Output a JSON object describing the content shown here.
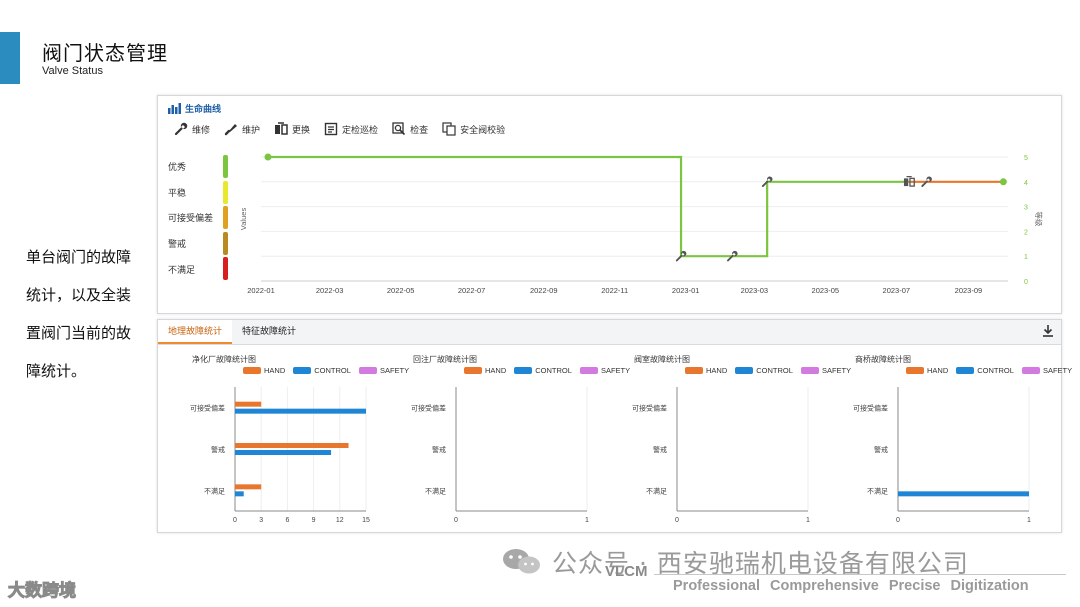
{
  "header": {
    "title": "阀门状态管理",
    "subtitle": "Valve Status"
  },
  "description": "单台阀门的故障统计，以及全装置阀门当前的故障统计。",
  "life_panel": {
    "title": "生命曲线",
    "toolbar": [
      {
        "label": "维修",
        "icon": "wrench-icon"
      },
      {
        "label": "维护",
        "icon": "brush-icon"
      },
      {
        "label": "更换",
        "icon": "replace-icon"
      },
      {
        "label": "定检巡检",
        "icon": "inspection-icon"
      },
      {
        "label": "检查",
        "icon": "check-search-icon"
      },
      {
        "label": "安全阀校验",
        "icon": "copy-verify-icon"
      }
    ],
    "levels": [
      {
        "label": "优秀",
        "color": "#7cc540"
      },
      {
        "label": "平稳",
        "color": "#e8e82c"
      },
      {
        "label": "可接受偏差",
        "color": "#e0a020"
      },
      {
        "label": "警戒",
        "color": "#b88a20"
      },
      {
        "label": "不满足",
        "color": "#d81e1e"
      }
    ]
  },
  "chart_data": [
    {
      "type": "line",
      "title": "生命曲线",
      "ylabel": "Values",
      "y2label": "等级",
      "ylim": [
        0,
        5
      ],
      "x_ticks": [
        "2022-01",
        "2022-03",
        "2022-05",
        "2022-07",
        "2022-09",
        "2022-11",
        "2023-01",
        "2023-03",
        "2023-05",
        "2023-07",
        "2023-09"
      ],
      "y_ticks": [
        0,
        1,
        2,
        3,
        4,
        5
      ],
      "series": [
        {
          "color": "#7cc540",
          "points": [
            [
              "2022-01-07",
              5
            ],
            [
              "2022-12-28",
              5
            ],
            [
              "2022-12-28",
              1
            ],
            [
              "2023-03-12",
              1
            ],
            [
              "2023-03-12",
              4
            ],
            [
              "2023-07-12",
              4
            ]
          ]
        },
        {
          "color": "#e8762c",
          "points": [
            [
              "2023-07-12",
              4
            ],
            [
              "2023-10-01",
              4
            ]
          ]
        }
      ],
      "markers": [
        {
          "date": "2022-12-28",
          "value": 1,
          "icon": "wrench-icon"
        },
        {
          "date": "2023-02-10",
          "value": 1,
          "icon": "wrench-icon"
        },
        {
          "date": "2023-03-12",
          "value": 4,
          "icon": "wrench-icon"
        },
        {
          "date": "2023-07-12",
          "value": 4,
          "icon": "replace-icon"
        },
        {
          "date": "2023-07-27",
          "value": 4,
          "icon": "wrench-icon"
        }
      ]
    },
    {
      "type": "bar",
      "orientation": "horizontal",
      "title": "净化厂故障统计图",
      "categories": [
        "可接受偏差",
        "警戒",
        "不满足"
      ],
      "series": [
        {
          "name": "HAND",
          "values": [
            3,
            13,
            3
          ]
        },
        {
          "name": "CONTROL",
          "values": [
            15,
            11,
            1
          ]
        },
        {
          "name": "SAFETY",
          "values": [
            0,
            0,
            0
          ]
        }
      ],
      "xlim": [
        0,
        15
      ],
      "x_ticks": [
        0,
        3,
        6,
        9,
        12,
        15
      ]
    },
    {
      "type": "bar",
      "orientation": "horizontal",
      "title": "回注厂故障统计图",
      "categories": [
        "可接受偏差",
        "警戒",
        "不满足"
      ],
      "series": [
        {
          "name": "HAND",
          "values": [
            0,
            0,
            0
          ]
        },
        {
          "name": "CONTROL",
          "values": [
            0,
            0,
            0
          ]
        },
        {
          "name": "SAFETY",
          "values": [
            0,
            0,
            0
          ]
        }
      ],
      "xlim": [
        0,
        1
      ],
      "x_ticks": [
        0,
        1
      ]
    },
    {
      "type": "bar",
      "orientation": "horizontal",
      "title": "阀室故障统计图",
      "categories": [
        "可接受偏差",
        "警戒",
        "不满足"
      ],
      "series": [
        {
          "name": "HAND",
          "values": [
            0,
            0,
            0
          ]
        },
        {
          "name": "CONTROL",
          "values": [
            0,
            0,
            0
          ]
        },
        {
          "name": "SAFETY",
          "values": [
            0,
            0,
            0
          ]
        }
      ],
      "xlim": [
        0,
        1
      ],
      "x_ticks": [
        0,
        1
      ]
    },
    {
      "type": "bar",
      "orientation": "horizontal",
      "title": "商桥故障统计图",
      "categories": [
        "可接受偏差",
        "警戒",
        "不满足"
      ],
      "series": [
        {
          "name": "HAND",
          "values": [
            0,
            0,
            0
          ]
        },
        {
          "name": "CONTROL",
          "values": [
            0,
            0,
            1
          ]
        },
        {
          "name": "SAFETY",
          "values": [
            0,
            0,
            0
          ]
        }
      ],
      "xlim": [
        0,
        1
      ],
      "x_ticks": [
        0,
        1
      ]
    }
  ],
  "series_colors": {
    "HAND": "#e8762c",
    "CONTROL": "#1f86d6",
    "SAFETY": "#d27ae0"
  },
  "stats_panel": {
    "tabs": [
      "地理故障统计",
      "特征故障统计"
    ],
    "active_tab": 0,
    "download_icon": "download-icon"
  },
  "footer": {
    "watermark": "公众号 · 西安驰瑞机电设备有限公司",
    "brand": "VLCM",
    "tagline": "Professional  Comprehensive  Precise  Digitization",
    "corner_watermark": "大数跨境"
  }
}
